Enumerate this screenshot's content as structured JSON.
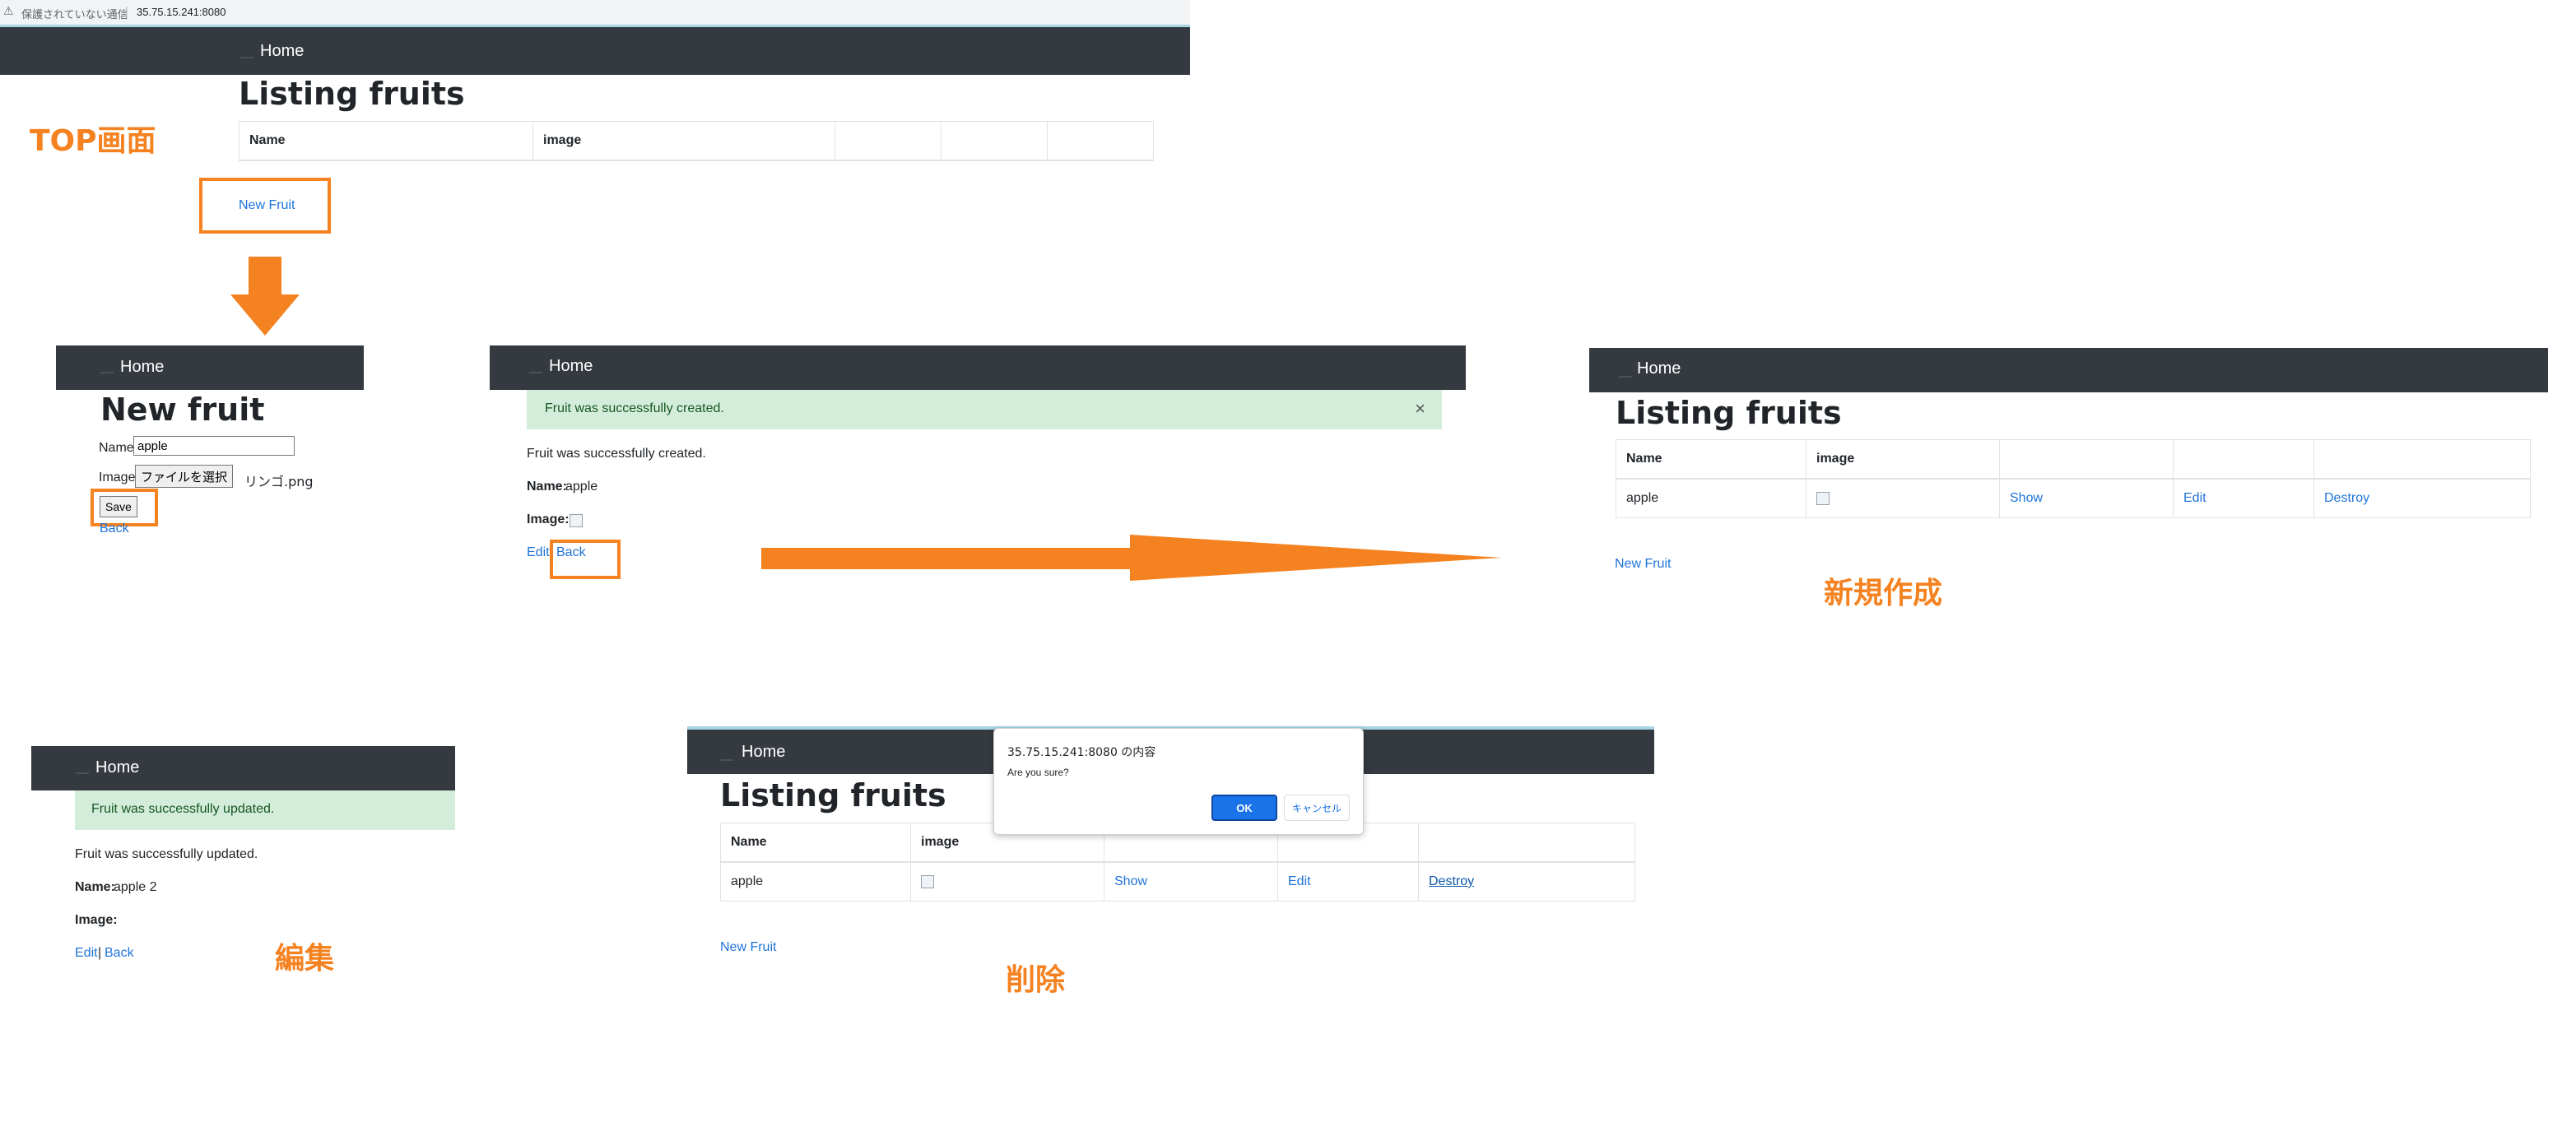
{
  "browser": {
    "security_label": "保護されていない通信",
    "url": "35.75.15.241:8080"
  },
  "nav": {
    "home": "Home"
  },
  "top": {
    "title": "Listing fruits",
    "headers": [
      "Name",
      "image",
      "",
      "",
      ""
    ],
    "new_link": "New Fruit",
    "annotation": "TOP画面"
  },
  "newpage": {
    "title": "New fruit",
    "name_label": "Name",
    "name_value": "apple",
    "image_label": "Image",
    "file_button": "ファイルを選択",
    "file_name": "リンゴ.png",
    "save": "Save",
    "back": "Back"
  },
  "created": {
    "alert": "Fruit was successfully created.",
    "alert_close": "×",
    "notice": "Fruit was successfully created.",
    "name_label": "Name:",
    "name_value": "apple",
    "image_label": "Image:",
    "edit": "Edit",
    "sep": "|",
    "back": "Back"
  },
  "listing": {
    "title": "Listing fruits",
    "headers": [
      "Name",
      "image",
      "",
      "",
      ""
    ],
    "row": {
      "name": "apple",
      "show": "Show",
      "edit": "Edit",
      "destroy": "Destroy"
    },
    "new_link": "New Fruit",
    "annotation": "新規作成"
  },
  "updated": {
    "alert": "Fruit was successfully updated.",
    "notice": "Fruit was successfully updated.",
    "name_label": "Name:",
    "name_value": "apple 2",
    "image_label": "Image:",
    "edit": "Edit",
    "sep": "|",
    "back": "Back",
    "annotation": "編集"
  },
  "deletion": {
    "title": "Listing fruits",
    "headers": [
      "Name",
      "image",
      "",
      "",
      ""
    ],
    "row": {
      "name": "apple",
      "show": "Show",
      "edit": "Edit",
      "destroy": "Destroy"
    },
    "new_link": "New Fruit",
    "annotation": "削除",
    "dialog": {
      "origin": "35.75.15.241:8080 の内容",
      "message": "Are you sure?",
      "ok": "OK",
      "cancel": "キャンセル"
    }
  },
  "colors": {
    "accent": "#f58220",
    "navbar": "#343a40",
    "link": "#1e73d8",
    "success_bg": "#d4edda"
  }
}
